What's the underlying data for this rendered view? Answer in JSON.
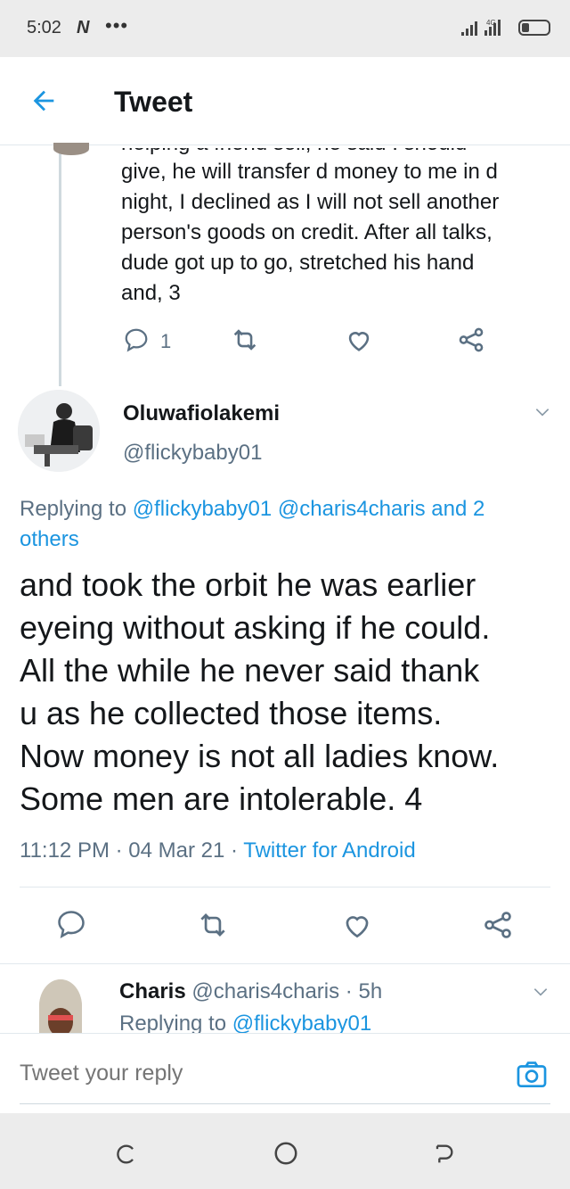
{
  "status_bar": {
    "time": "5:02",
    "notification_icon": "N",
    "more": "•••",
    "network": "4G"
  },
  "header": {
    "back_icon": "arrow-left-icon",
    "title": "Tweet"
  },
  "previous_tweet": {
    "text_lines": [
      "helping a friend sell, he said I should",
      "give, he will transfer d money to me in d",
      "night, I declined as I will not sell another",
      "person's goods on credit. After all talks,",
      "dude got up to go, stretched his hand",
      "and, 3"
    ],
    "reply_count": "1"
  },
  "main_tweet": {
    "name": "Oluwafiolakemi",
    "handle": "@flickybaby01",
    "replying_prefix": "Replying to ",
    "replying_mention_1": "@flickybaby01",
    "replying_mention_2": "@charis4charis",
    "replying_rest_1": " and 2",
    "replying_rest_2": "others",
    "text_lines": [
      "and took the orbit he was earlier",
      "eyeing without asking if he could.",
      "All the while he never said thank",
      "u as he collected those items.",
      "Now money is not all ladies know.",
      "Some men are intolerable. 4"
    ],
    "time": "11:12 PM",
    "date": "04 Mar 21",
    "separator": "·",
    "source": "Twitter for Android"
  },
  "reply_tweet": {
    "name": "Charis",
    "handle": "@charis4charis",
    "time": "5h",
    "separator": "·",
    "replying_prefix": "Replying to ",
    "replying_mention": "@flickybaby01"
  },
  "reply_bar": {
    "placeholder": "Tweet your reply"
  },
  "colors": {
    "accent": "#1b95e0",
    "muted": "#5b7083",
    "text": "#14171a"
  }
}
